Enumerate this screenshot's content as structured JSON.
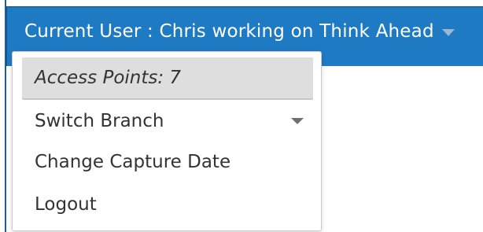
{
  "header": {
    "current_user": "Current User : Chris working on Think Ahead"
  },
  "menu": {
    "selected_item": "Access Points: 7",
    "items": [
      "Switch Branch",
      "Change Capture Date",
      "Logout"
    ]
  },
  "icons": {
    "user_menu": "chevron-down-icon",
    "switch_branch": "chevron-down-icon"
  },
  "colors": {
    "header_bar": "#1f7ac4",
    "menu_background": "#ffffff",
    "selected_item_background": "#dedede"
  }
}
